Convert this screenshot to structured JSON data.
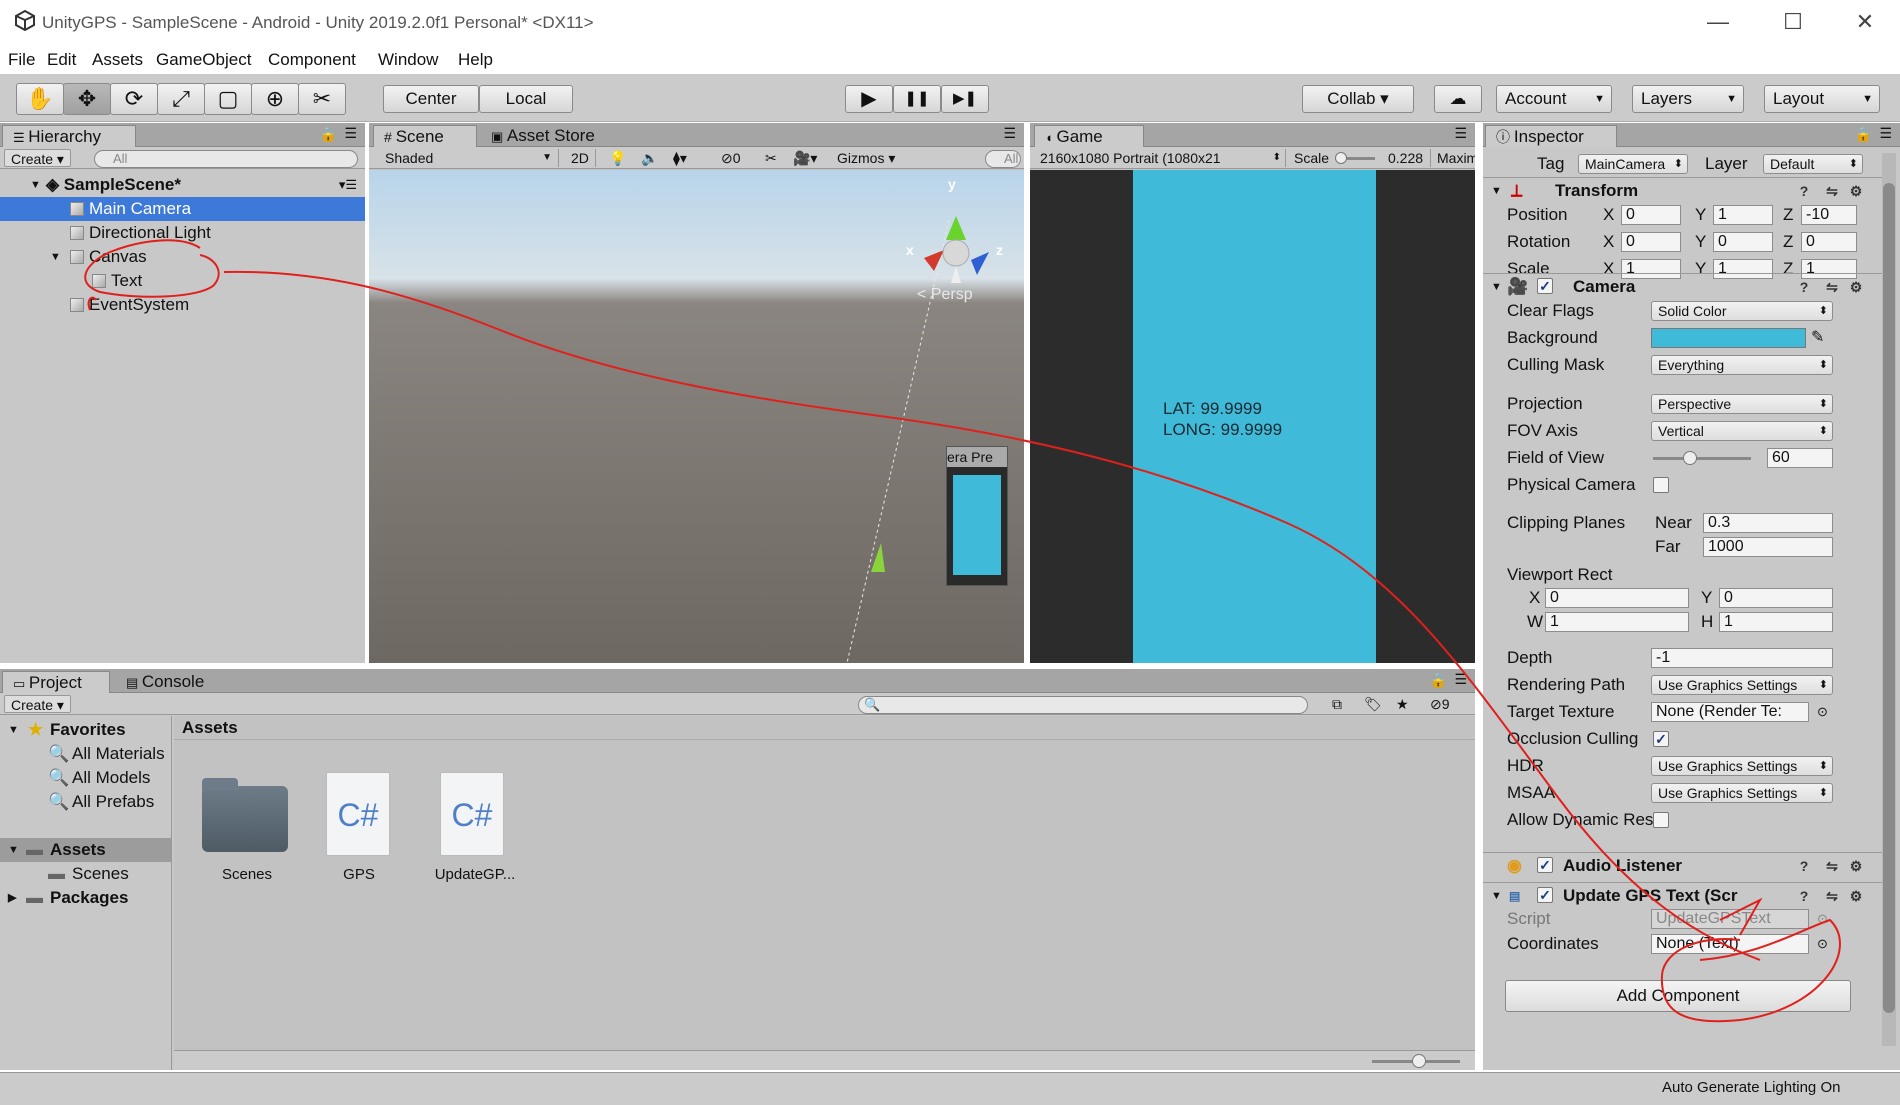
{
  "window": {
    "title": "UnityGPS - SampleScene - Android - Unity 2019.2.0f1 Personal* <DX11>",
    "minimize": "—",
    "maximize": "☐",
    "close": "✕"
  },
  "menu": [
    "File",
    "Edit",
    "Assets",
    "GameObject",
    "Component",
    "Window",
    "Help"
  ],
  "toolbar": {
    "tools": [
      "✋",
      "✥",
      "⟳",
      "⤢",
      "▢",
      "⊕",
      "✂"
    ],
    "pivot": "Center",
    "space": "Local",
    "play": "▶",
    "pause": "❚❚",
    "step": "▶❚",
    "collab": "Collab ▾",
    "cloud": "☁",
    "account": "Account",
    "layers": "Layers",
    "layout": "Layout"
  },
  "hierarchy": {
    "tab": "Hierarchy",
    "create": "Create ▾",
    "search": "All",
    "scene": "SampleScene*",
    "items": [
      "Main Camera",
      "Directional Light",
      "Canvas",
      "Text",
      "EventSystem"
    ]
  },
  "scene": {
    "tabs": [
      "Scene",
      "Asset Store"
    ],
    "shading": "Shaded",
    "mode2d": "2D",
    "hidden_count": "0",
    "gizmos": "Gizmos",
    "search": "All",
    "persp": "< Persp",
    "axis_y": "y",
    "axis_x": "x",
    "axis_z": "z",
    "cam_preview": "era Pre"
  },
  "game": {
    "tab": "Game",
    "resolution": "2160x1080 Portrait (1080x21",
    "scale_label": "Scale",
    "scale_value": "0.228",
    "maximize": "Maxim",
    "lat": "LAT: 99.9999",
    "long": "LONG: 99.9999",
    "bg_color": "#3fbad8"
  },
  "inspector": {
    "tab": "Inspector",
    "tag_label": "Tag",
    "tag": "MainCamera",
    "layer_label": "Layer",
    "layer": "Default",
    "transform": {
      "title": "Transform",
      "rows": [
        {
          "label": "Position",
          "x": "0",
          "y": "1",
          "z": "-10"
        },
        {
          "label": "Rotation",
          "x": "0",
          "y": "0",
          "z": "0"
        },
        {
          "label": "Scale",
          "x": "1",
          "y": "1",
          "z": "1"
        }
      ],
      "axis_x": "X",
      "axis_y": "Y",
      "axis_z": "Z"
    },
    "camera": {
      "title": "Camera",
      "clear_flags_label": "Clear Flags",
      "clear_flags": "Solid Color",
      "background_label": "Background",
      "background_color": "#3fbad8",
      "culling_mask_label": "Culling Mask",
      "culling_mask": "Everything",
      "projection_label": "Projection",
      "projection": "Perspective",
      "fov_axis_label": "FOV Axis",
      "fov_axis": "Vertical",
      "fov_label": "Field of View",
      "fov": "60",
      "physical_label": "Physical Camera",
      "clipping_label": "Clipping Planes",
      "near_label": "Near",
      "near": "0.3",
      "far_label": "Far",
      "far": "1000",
      "viewport_label": "Viewport Rect",
      "vx_label": "X",
      "vx": "0",
      "vy_label": "Y",
      "vy": "0",
      "vw_label": "W",
      "vw": "1",
      "vh_label": "H",
      "vh": "1",
      "depth_label": "Depth",
      "depth": "-1",
      "rendering_label": "Rendering Path",
      "rendering": "Use Graphics Settings",
      "target_label": "Target Texture",
      "target": "None (Render Te:",
      "occlusion_label": "Occlusion Culling",
      "hdr_label": "HDR",
      "hdr": "Use Graphics Settings",
      "msaa_label": "MSAA",
      "msaa": "Use Graphics Settings",
      "dynres_label": "Allow Dynamic Resol"
    },
    "audio": {
      "title": "Audio Listener"
    },
    "script": {
      "title": "Update GPS Text (Scr",
      "script_label": "Script",
      "script": "UpdateGPSText",
      "coord_label": "Coordinates",
      "coord": "None (Text)"
    },
    "add_component": "Add Component"
  },
  "project": {
    "tabs": [
      "Project",
      "Console"
    ],
    "create": "Create ▾",
    "hidden_count": "9",
    "favorites": "Favorites",
    "fav_items": [
      "All Materials",
      "All Models",
      "All Prefabs"
    ],
    "assets_root": "Assets",
    "scenes": "Scenes",
    "packages": "Packages",
    "breadcrumb": "Assets",
    "files": [
      {
        "name": "Scenes",
        "kind": "folder"
      },
      {
        "name": "GPS",
        "kind": "cs"
      },
      {
        "name": "UpdateGP...",
        "kind": "cs"
      }
    ],
    "cs_glyph": "C#"
  },
  "status": {
    "text": "Auto Generate Lighting On"
  }
}
